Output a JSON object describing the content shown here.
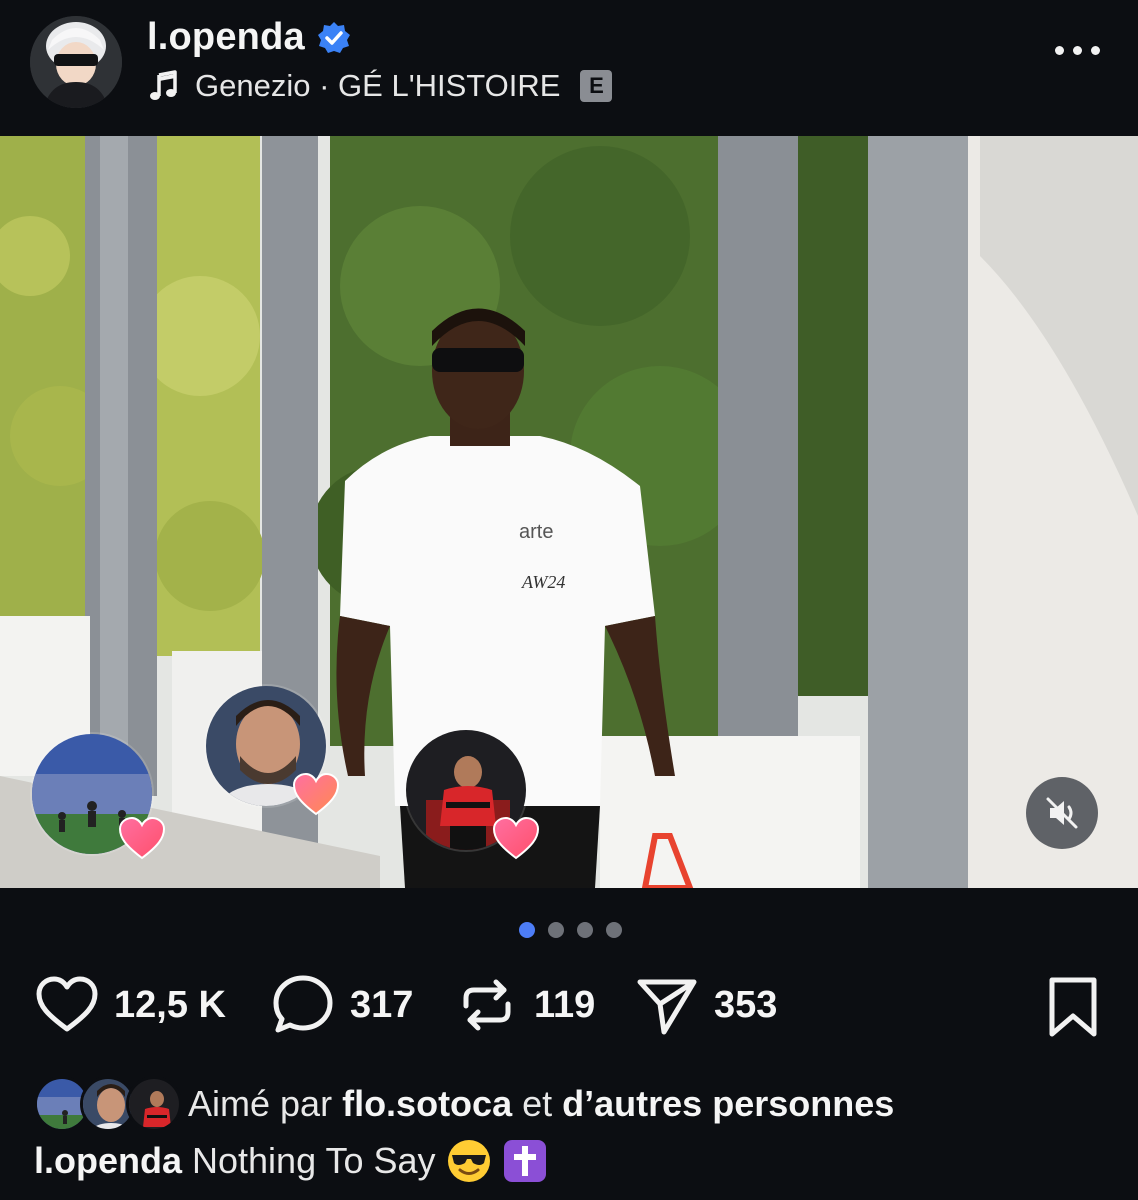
{
  "post": {
    "username": "l.openda",
    "music": {
      "artist": "Genezio",
      "separator": "·",
      "title": "GÉ L'HISTOIRE",
      "explicit_label": "E"
    },
    "photo": {
      "shirt_brand": "arte",
      "shirt_code": "AW24"
    },
    "pagination": {
      "total": 4,
      "active": 0
    },
    "stats": {
      "likes": "12,5 K",
      "comments": "317",
      "reposts": "119",
      "shares": "353"
    },
    "liked_by": {
      "prefix": "Aimé par",
      "user": "flo.sotoca",
      "connector": "et",
      "others": "d’autres personnes"
    },
    "caption": {
      "username": "l.openda",
      "text": "Nothing To Say"
    },
    "colors": {
      "background": "#0c0e12",
      "verified": "#3b82f6",
      "active_dot": "#4d7df6",
      "heart": "#ff4f7b"
    },
    "icons": [
      "verified-icon",
      "music-note-icon",
      "more-icon",
      "mute-icon",
      "heart-icon",
      "comment-icon",
      "repost-icon",
      "share-icon",
      "bookmark-icon",
      "sunglasses-emoji",
      "cross-emoji"
    ]
  }
}
